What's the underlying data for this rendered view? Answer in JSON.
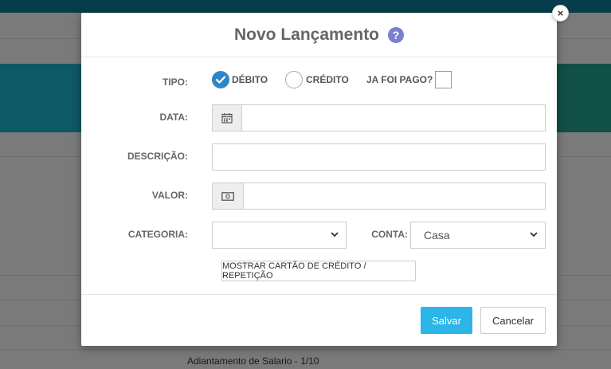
{
  "background": {
    "row_text": "Adiantamento de Salario - 1/10"
  },
  "modal": {
    "title": "Novo Lançamento",
    "help_icon": "question-circle-icon",
    "close_icon": "close-icon",
    "close_glyph": "×",
    "fields": {
      "tipo_label": "TIPO:",
      "debito_label": "DÉBITO",
      "credito_label": "CRÉDITO",
      "selected_tipo": "DÉBITO",
      "pago_label": "JA FOI PAGO?",
      "data_label": "DATA:",
      "data_value": "",
      "descricao_label": "DESCRIÇÃO:",
      "descricao_value": "",
      "valor_label": "VALOR:",
      "valor_value": "",
      "categoria_label": "CATEGORIA:",
      "categoria_value": "",
      "conta_label": "CONTA:",
      "conta_value": "Casa"
    },
    "toggle_button": "MOSTRAR CARTÃO DE CRÉDITO / REPETIÇÃO",
    "save_button": "Salvar",
    "cancel_button": "Cancelar"
  },
  "colors": {
    "accent": "#2bb5e8",
    "radio_on": "#2e86c7",
    "help": "#7a7fcf"
  }
}
